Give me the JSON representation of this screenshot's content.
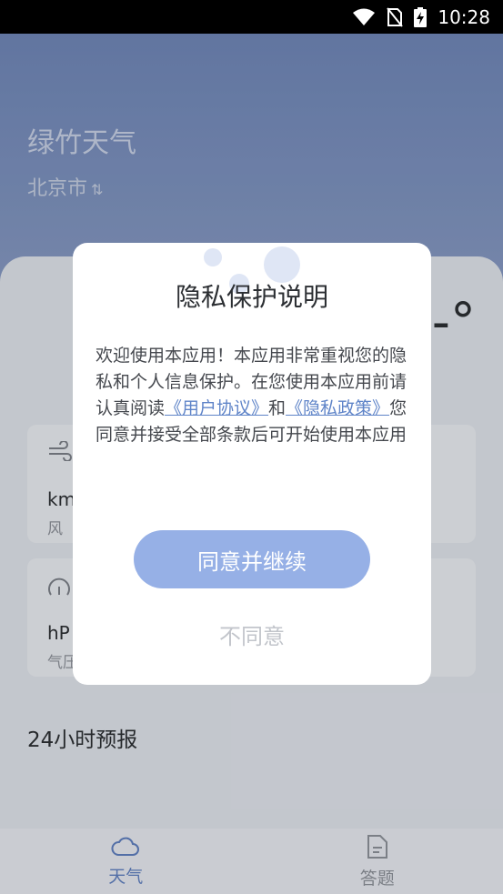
{
  "status_bar": {
    "time": "10:28"
  },
  "header": {
    "app_title": "绿竹天气",
    "city": "北京市",
    "city_switch_glyph": "⇅"
  },
  "main": {
    "temperature_degree": "-°",
    "stats": [
      {
        "icon": "wind-icon",
        "unit": "km",
        "label": "风"
      },
      {
        "icon": "pressure-icon",
        "unit": "hP",
        "label": "气压"
      }
    ],
    "forecast_title": "24小时预报"
  },
  "dialog": {
    "title": "隐私保护说明",
    "body_part1": "欢迎使用本应用！本应用非常重视您的隐私和个人信息保护。在您使用本应用前请认真阅读",
    "user_agreement_link": "《用户协议》",
    "and_text": "和",
    "privacy_policy_link": "《隐私政策》",
    "body_part2": "您同意并接受全部条款后可开始使用本应用",
    "agree_label": "同意并继续",
    "disagree_label": "不同意"
  },
  "tabs": [
    {
      "label": "天气",
      "icon": "cloud-icon",
      "active": true
    },
    {
      "label": "答题",
      "icon": "document-icon",
      "active": false
    }
  ],
  "colors": {
    "accent": "#5f7fbf",
    "button": "#96b0e6",
    "link": "#5f84c8"
  }
}
